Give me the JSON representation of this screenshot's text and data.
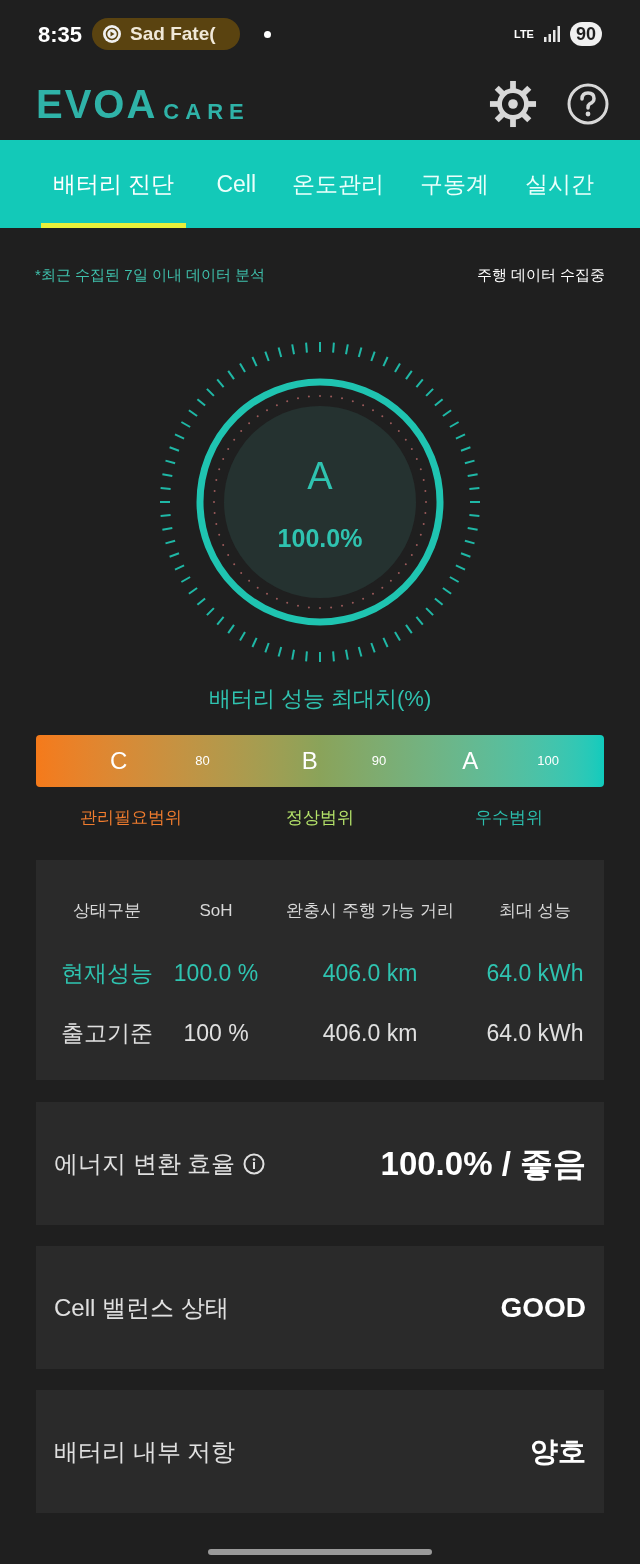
{
  "status_bar": {
    "time": "8:35",
    "media": "Sad Fate(",
    "network": "LTE",
    "battery": "90"
  },
  "header": {
    "logo_main": "EVOA",
    "logo_sub": "CARE"
  },
  "tabs": [
    {
      "label": "배터리 진단",
      "selected": true
    },
    {
      "label": "Cell",
      "selected": false
    },
    {
      "label": "온도관리",
      "selected": false
    },
    {
      "label": "구동계",
      "selected": false
    },
    {
      "label": "실시간",
      "selected": false
    }
  ],
  "note": "*최근 수집된 7일 이내 데이터 분석",
  "collecting": "주행 데이터 수집중",
  "gauge": {
    "grade": "A",
    "value": "100.0%",
    "level": 1.0,
    "caption": "배터리 성능 최대치(%)"
  },
  "scale": {
    "marks": [
      {
        "kind": "grade",
        "text": "C"
      },
      {
        "kind": "tick",
        "text": "80"
      },
      {
        "kind": "grade",
        "text": "B"
      },
      {
        "kind": "tick",
        "text": "90"
      },
      {
        "kind": "grade",
        "text": "A"
      },
      {
        "kind": "tick",
        "text": "100"
      }
    ],
    "ranges": [
      {
        "label": "관리필요범위",
        "color": "#f07c2e"
      },
      {
        "label": "정상범위",
        "color": "#b5e36a"
      },
      {
        "label": "우수범위",
        "color": "#2bbfae"
      }
    ]
  },
  "table": {
    "columns": [
      "상태구분",
      "SoH",
      "완충시 주행 가능 거리",
      "최대 성능"
    ],
    "rows": [
      {
        "highlighted": true,
        "cells": [
          "현재성능",
          "100.0 %",
          "406.0 km",
          "64.0 kWh"
        ]
      },
      {
        "highlighted": false,
        "cells": [
          "출고기준",
          "100 %",
          "406.0 km",
          "64.0 kWh"
        ]
      }
    ]
  },
  "cards": [
    {
      "label": "에너지 변환 효율",
      "info": true,
      "value": "100.0% / 좋음"
    },
    {
      "label": "Cell 밸런스 상태",
      "info": false,
      "value": "GOOD"
    },
    {
      "label": "배터리 내부 저항",
      "info": false,
      "value": "양호"
    }
  ]
}
